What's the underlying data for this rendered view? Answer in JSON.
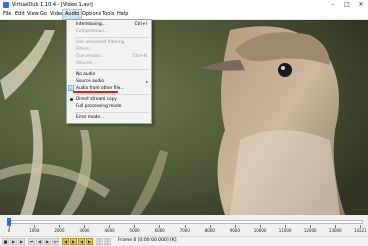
{
  "window": {
    "title": "VirtualDub 1.10.4 - [Video 1.avi]"
  },
  "menubar": [
    "File",
    "Edit",
    "View",
    "Go",
    "Video",
    "Audio",
    "Options",
    "Tools",
    "Help"
  ],
  "audio_menu": {
    "items": [
      {
        "label": "Interleaving...",
        "shortcut": "Ctrl+I",
        "disabled": false
      },
      {
        "label": "Compression...",
        "disabled": true
      },
      {
        "label": "Use advanced filtering",
        "disabled": true
      },
      {
        "label": "Filters...",
        "disabled": true
      },
      {
        "label": "Conversion...",
        "shortcut": "Ctrl+N",
        "disabled": true
      },
      {
        "label": "Volume...",
        "disabled": true
      },
      {
        "label": "No audio",
        "disabled": false
      },
      {
        "label": "Source audio",
        "disabled": false,
        "submenu": true
      },
      {
        "label": "Audio from other file...",
        "disabled": false,
        "checked": true
      },
      {
        "label": "Direct stream copy",
        "disabled": false,
        "bullet": true
      },
      {
        "label": "Full processing mode",
        "disabled": false
      },
      {
        "label": "Error mode...",
        "disabled": false
      }
    ]
  },
  "timeline": {
    "ticks": [
      "0",
      "1000",
      "2000",
      "3000",
      "4000",
      "5000",
      "6000",
      "7000",
      "8000",
      "9000",
      "10000",
      "11000",
      "12000",
      "13000",
      "14221"
    ],
    "position_fraction": 0.0
  },
  "status": {
    "frame": "Frame 0 [0:00:00.000] [K]"
  },
  "colors": {
    "menu_highlight": "#cce4f7",
    "annotation": "#e02020",
    "thumb": "#2f6fd6"
  }
}
